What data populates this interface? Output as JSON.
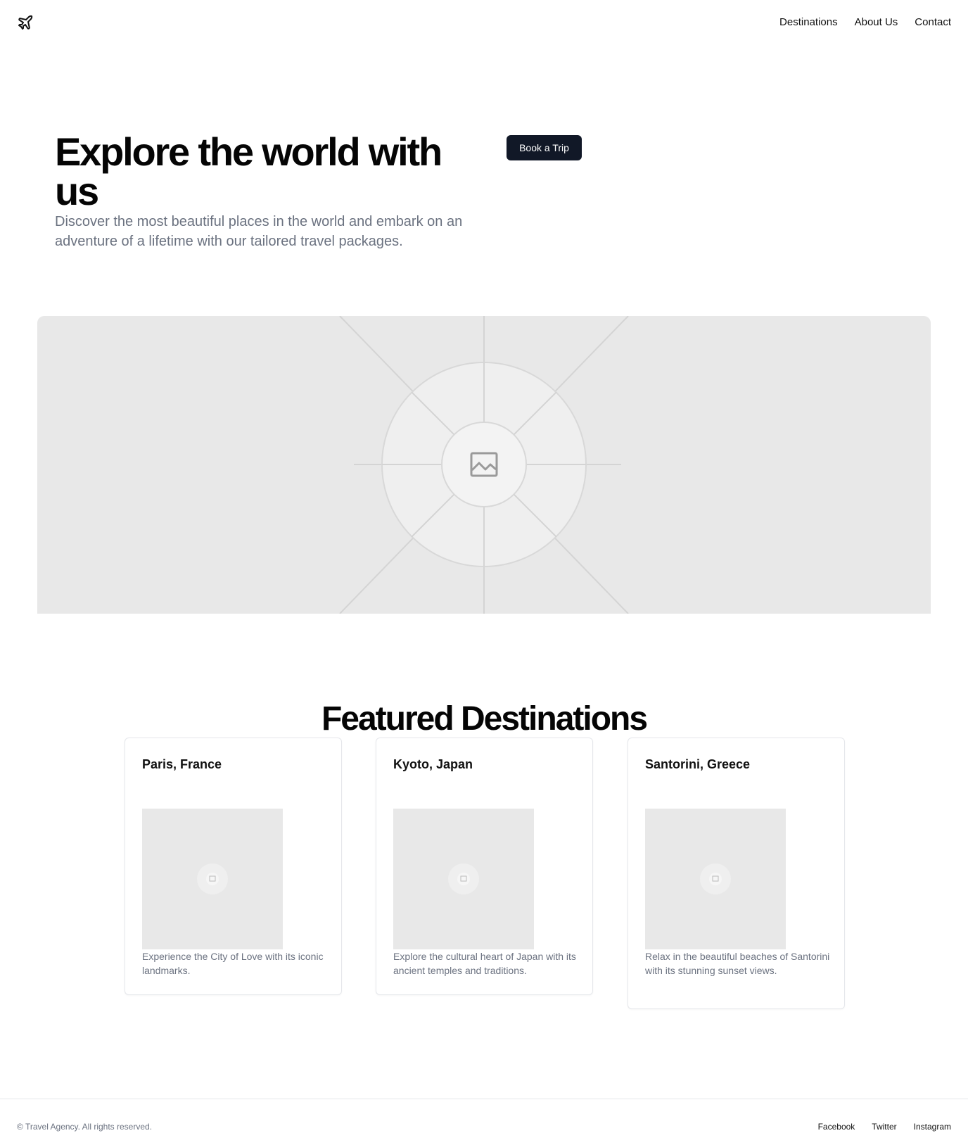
{
  "header": {
    "logo_icon": "airplane-icon",
    "nav": [
      {
        "label": "Destinations"
      },
      {
        "label": "About Us"
      },
      {
        "label": "Contact"
      }
    ]
  },
  "hero": {
    "title": "Explore the world with us",
    "description": "Discover the most beautiful places in the world and embark on an adventure of a lifetime with our tailored travel packages.",
    "cta_label": "Book a Trip",
    "image_icon": "image-placeholder-icon"
  },
  "featured": {
    "title": "Featured Destinations",
    "cards": [
      {
        "title": "Paris, France",
        "description": "Experience the City of Love with its iconic landmarks."
      },
      {
        "title": "Kyoto, Japan",
        "description": "Explore the cultural heart of Japan with its ancient temples and traditions."
      },
      {
        "title": "Santorini, Greece",
        "description": "Relax in the beautiful beaches of Santorini with its stunning sunset views."
      }
    ]
  },
  "footer": {
    "copyright": "© Travel Agency. All rights reserved.",
    "links": [
      {
        "label": "Facebook"
      },
      {
        "label": "Twitter"
      },
      {
        "label": "Instagram"
      }
    ]
  },
  "colors": {
    "primary_button": "#111827",
    "muted_text": "#6b7280",
    "placeholder_bg": "#e8e8e8",
    "border": "#e5e7eb"
  }
}
